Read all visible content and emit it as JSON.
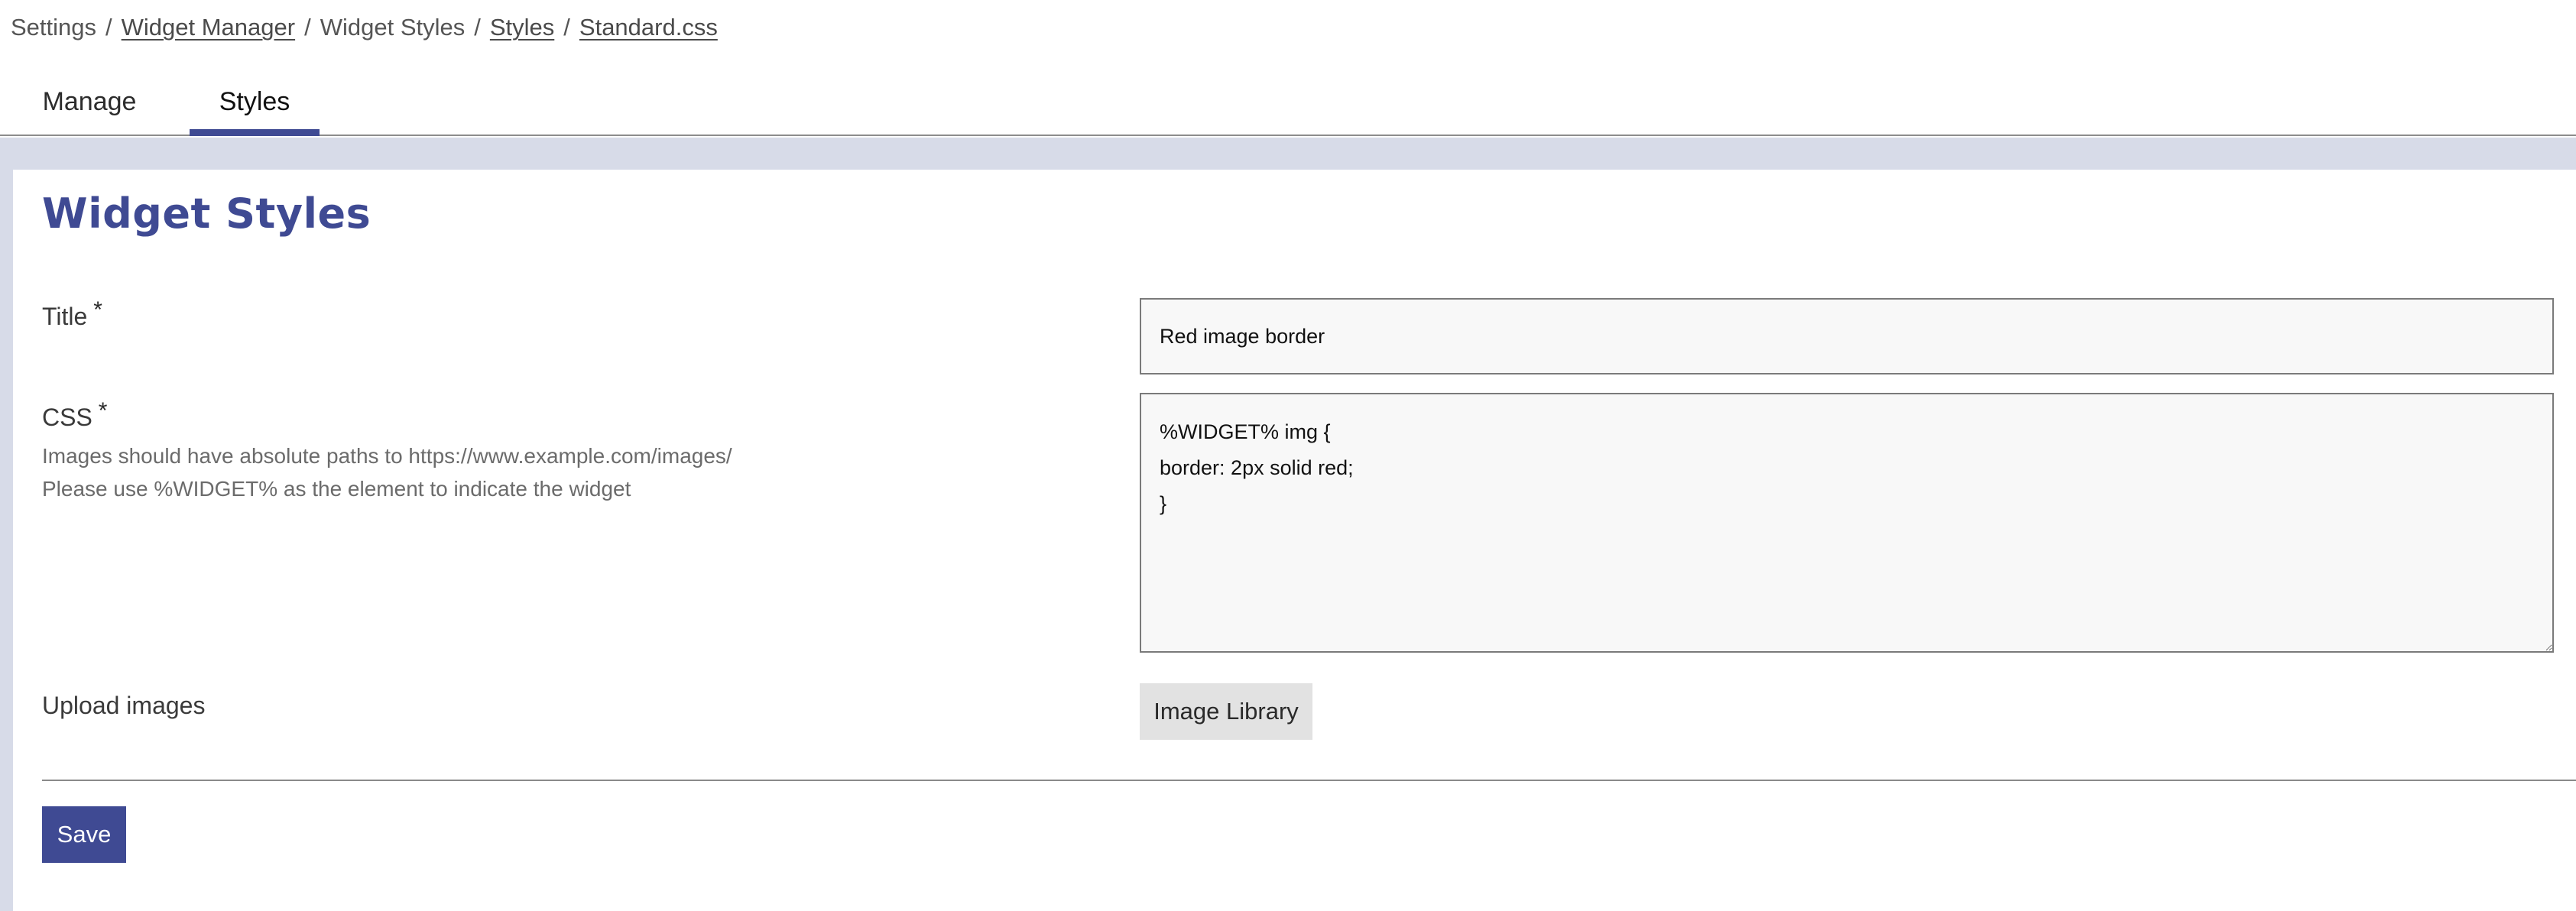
{
  "breadcrumb": {
    "items": [
      {
        "label": "Settings",
        "link": false
      },
      {
        "label": "Widget Manager",
        "link": true
      },
      {
        "label": "Widget Styles",
        "link": false
      },
      {
        "label": "Styles",
        "link": true
      },
      {
        "label": "Standard.css",
        "link": true
      }
    ],
    "separator": "/"
  },
  "tabs": [
    {
      "label": "Manage",
      "active": false
    },
    {
      "label": "Styles",
      "active": true
    }
  ],
  "page": {
    "title": "Widget Styles"
  },
  "form": {
    "title_field": {
      "label": "Title",
      "required_marker": "*",
      "value": "Red image border"
    },
    "css_field": {
      "label": "CSS",
      "required_marker": "*",
      "help_lines": [
        "Images should have absolute paths to https://www.example.com/images/",
        "Please use %WIDGET% as the element to indicate the widget"
      ],
      "value": "%WIDGET% img {\nborder: 2px solid red;\n}"
    },
    "upload": {
      "label": "Upload images",
      "button_label": "Image Library"
    },
    "save_label": "Save"
  },
  "colors": {
    "accent": "#3f4a93",
    "band_background": "#d7dbe8",
    "input_background": "#f8f8f8",
    "secondary_button": "#e2e2e2"
  }
}
